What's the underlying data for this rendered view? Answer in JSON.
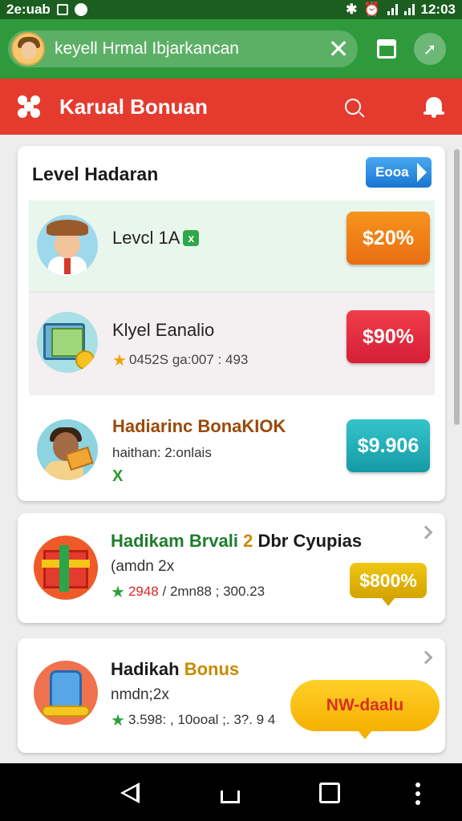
{
  "status_bar": {
    "left_text": "2e:uab",
    "time": "12:03"
  },
  "browser": {
    "url_text": "keyell Hrmal Ibjarkancan",
    "close_icon": "close-icon",
    "tabs_icon": "tabs-icon",
    "share_icon": "share-icon"
  },
  "app_header": {
    "title": "Karual Bonuan",
    "accent": "#e53b2e"
  },
  "level_card": {
    "title": "Level Hadaran",
    "see_button": "Eooa",
    "rows": [
      {
        "title": "Levcl 1A",
        "badge": "x",
        "price": "$20%",
        "price_color": "#f7941d"
      },
      {
        "title": "Klyel Eanalio",
        "subtitle": "0452S ga:007 : 493",
        "price": "$90%",
        "price_color": "#e8303e"
      },
      {
        "title": "Hadiarinc BonaKIOK",
        "subtitle": "haithan: 2:onlais",
        "mark": "X",
        "price": "$9.906",
        "price_color": "#28b4be"
      }
    ]
  },
  "promos": [
    {
      "title_green": "Hadikam Brvali",
      "title_gold": "2",
      "title_dark": "Dbr Cyupias",
      "subtitle": "(amdn 2x",
      "stats_red": "2948",
      "stats_rest": "/ 2mn88 ; 300.23",
      "price": "$800%",
      "price_color": "#e0b300"
    },
    {
      "title_dark": "Hadikah",
      "title_gold": "Bonus",
      "subtitle": "nmdn;2x",
      "stats": "3.598: , 10ooal ;. 3?. 9 4",
      "cta": "NW-daalu",
      "cta_color": "#f5b000"
    }
  ]
}
